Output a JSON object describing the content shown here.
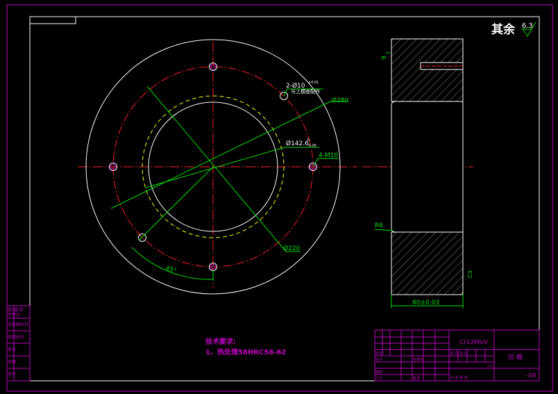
{
  "colors": {
    "background": "#000000",
    "frame": "#ffffff",
    "sheet_border": "#c000c0",
    "centerline": "#ff2020",
    "dimension": "#00e000",
    "hidden_line": "#ffff00",
    "title_text": "#c000c0",
    "hatch": "#8a8a8a"
  },
  "surface_finish": {
    "label": "其余",
    "value": "6.3"
  },
  "front_view": {
    "hole_note_line1": "2-Ø10",
    "hole_note_tol": "+0.01",
    "hole_note_line2": "与上模座配作",
    "dim_outer": "Ø280",
    "dim_bore": "Ø142.6",
    "dim_bore_tol_upper": "0",
    "dim_bore_tol_lower": "-0.05",
    "dim_thread": "4-M10",
    "dim_pitch": "Ø220",
    "dim_angle": "45°"
  },
  "side_view": {
    "dim_depth": "9",
    "dim_radius": "R6",
    "dim_width": "80±0.03",
    "dim_chamfer": "C3"
  },
  "tech_requirements": {
    "title": "技术要求:",
    "item1": "1、热处理58HRC58-62"
  },
  "left_strip": [
    "借(通)用",
    "件登记",
    "旧底图总号",
    "底图总号",
    "签名",
    "日期",
    "签字",
    "日期"
  ],
  "title_block": {
    "material": "Cr12MoV",
    "part_name": "凹 模",
    "drawing_no": "-04",
    "row_labels": [
      "标记",
      "处数",
      "分区",
      "更改文件号",
      "签名",
      "年.月.日"
    ],
    "sub_labels": [
      "设计",
      "标准化",
      "审核",
      "工艺",
      "批准"
    ],
    "stage_labels": [
      "阶 段 标 记",
      "重量",
      "比例"
    ],
    "scale": "1:1",
    "sheet": "共 张 第 张"
  }
}
